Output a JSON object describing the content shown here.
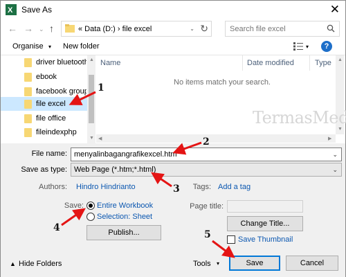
{
  "window": {
    "title": "Save As",
    "close_glyph": "✕"
  },
  "nav": {
    "back_glyph": "←",
    "forward_glyph": "→",
    "recent_glyph": "⌄",
    "up_glyph": "↑",
    "address_path": "«  Data (D:)  ›  file excel",
    "address_drop_glyph": "⌄",
    "refresh_glyph": "↻",
    "search_placeholder": "Search file excel"
  },
  "toolbar": {
    "organise_label": "Organise",
    "new_folder_label": "New folder",
    "drop_glyph": "▾"
  },
  "tree": {
    "items": [
      {
        "label": "driver bluetooth"
      },
      {
        "label": "ebook"
      },
      {
        "label": "facebook group"
      },
      {
        "label": "file excel"
      },
      {
        "label": "file office"
      },
      {
        "label": "fileindexphp"
      }
    ],
    "selected_index": 3
  },
  "list": {
    "columns": [
      "Name",
      "Date modified",
      "Type"
    ],
    "empty_message": "No items match your search."
  },
  "watermark": "TermasMedia",
  "form": {
    "file_name_label": "File name:",
    "file_name_value": "menyalinbagangrafikexcel.htm",
    "save_as_type_label": "Save as type:",
    "save_as_type_value": "Web Page (*.htm;*.html)",
    "authors_label": "Authors:",
    "authors_value": "Hindro Hindrianto",
    "tags_label": "Tags:",
    "tags_value": "Add a tag",
    "save_label": "Save:",
    "entire_workbook_label": "Entire Workbook",
    "selection_label": "Selection: Sheet",
    "save_scope_selected": "Entire Workbook",
    "publish_label": "Publish...",
    "page_title_label": "Page title:",
    "change_title_label": "Change Title...",
    "save_thumbnail_label": "Save Thumbnail",
    "hide_folders_label": "Hide Folders",
    "tools_label": "Tools",
    "save_button_label": "Save",
    "cancel_button_label": "Cancel"
  },
  "annotations": [
    "1",
    "2",
    "3",
    "4",
    "5"
  ],
  "colors": {
    "accent": "#0078d7",
    "link": "#0b57b0",
    "annotation_arrow": "#e41414",
    "selection": "#cce8ff",
    "folder": "#f7d774"
  }
}
